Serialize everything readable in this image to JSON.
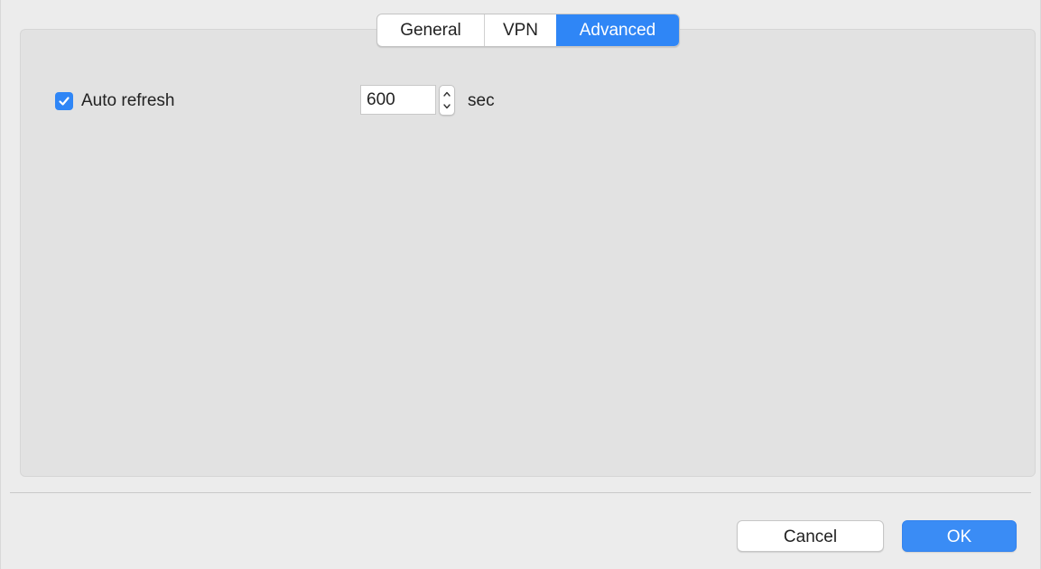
{
  "tabs": [
    {
      "label": "General",
      "selected": false
    },
    {
      "label": "VPN",
      "selected": false
    },
    {
      "label": "Advanced",
      "selected": true
    }
  ],
  "advanced": {
    "auto_refresh": {
      "label": "Auto refresh",
      "checked": true,
      "value": "600",
      "unit": "sec"
    }
  },
  "footer": {
    "cancel_label": "Cancel",
    "ok_label": "OK"
  },
  "colors": {
    "accent": "#2f86f6",
    "panel_bg": "#e2e2e2",
    "window_bg": "#ececec"
  },
  "icons": {
    "checkbox": "checkmark-icon",
    "stepper_up": "chevron-up-icon",
    "stepper_down": "chevron-down-icon"
  }
}
